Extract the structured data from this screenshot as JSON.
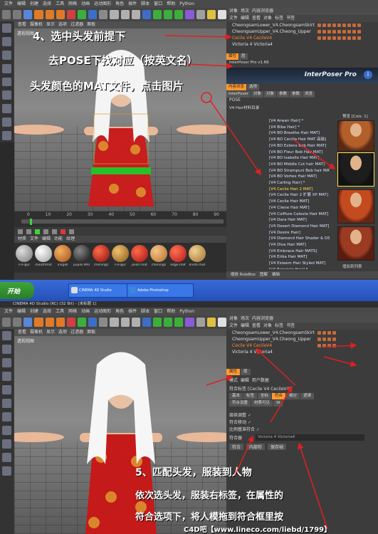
{
  "top": {
    "menu": [
      "文件",
      "编辑",
      "创建",
      "选择",
      "工具",
      "网格",
      "动画",
      "运动图形",
      "角色",
      "插件",
      "脚本",
      "窗口",
      "帮助",
      "Python"
    ],
    "viewport": {
      "menu": [
        "查看",
        "摄像机",
        "显示",
        "选项",
        "过滤器",
        "面板"
      ],
      "label": "透视视图"
    },
    "objects": {
      "header": [
        "对象",
        "场次",
        "内容浏览器"
      ],
      "menu": [
        "文件",
        "编辑",
        "查看",
        "对象",
        "标签",
        "书签"
      ],
      "rows": [
        "CheongsamLower_V4.CheongsamSkirt",
        "CheongsamUpper_V4.Cheong_Upper",
        "Cecile V4 CecileV4",
        "Victoria 4 Victoria4"
      ]
    },
    "interposer": {
      "tabs": [
        "属性",
        "层"
      ],
      "version": "InterPoser Pro v1.66",
      "brand": "InterPoser Pro",
      "info_icon": "info-icon",
      "subtabs": [
        "内容浏览",
        "选项"
      ],
      "tabs2": [
        "InterPoser",
        "对象",
        "对象",
        "参数",
        "参数",
        "浏览"
      ],
      "pose_header": "POSE",
      "tree_label": "V4 Hair材料目录",
      "mat_items": [
        "[V4 Arwen Hair] *",
        "[V4 Biba Hair] *",
        "[V4 BO Breathe Hair MAT]",
        "[V4 BO Cecilia Hair MAT 高级]",
        "[V4 BO Extens Bob Hair MAT]",
        "[V4 BO Fleur Bob Hair MAT]",
        "[V4 BO Isabelle Hair MAT]",
        "[V4 BO Middle Cut hair MAT]",
        "[V4 BO Strampuni Bob hair MAT]",
        "[V4 BO Vortex Hair MAT]",
        "[V4 Carling Hair] *",
        "[V4 Cecile Hair 2 MAT]",
        "[V4 Cecile Hair 2 扩展 XP MAT]",
        "[V4 Cecile Hair MAT]",
        "[V4 Cilene Hair MAT]",
        "[V4 Coiffure Celeste Hair MAT]",
        "[V4 Dara Hair MAT]",
        "[V4 Desert Diamond Hair MAT]",
        "[V4 Desire Hair]",
        "[V4 Diamond Hair Shader & DS]",
        "[V4 Diva Hair MAT]",
        "[V4 Embrace Hair MATS]",
        "[V4 Erika Hair MAT]",
        "[V4 Esteem Hair Styled MAT]",
        "[V4 Fairytale Hair] *",
        "[V4 Flapshy Hair MAT]"
      ],
      "highlight_index": 11,
      "preview_label": "预览 [Cols: 1]",
      "add_button": "增加到列表",
      "footer": [
        "缩放 RuleBox",
        "图解",
        "编辑"
      ]
    },
    "timeline": {
      "ticks": [
        "0",
        "10",
        "20",
        "30",
        "40",
        "50",
        "60",
        "70",
        "80",
        "90"
      ]
    },
    "materials": {
      "menu": [
        "材质",
        "文件",
        "编辑",
        "功能",
        "纹理"
      ],
      "items": [
        "FFFigur",
        "mouthmat",
        "irisgall",
        "pupils.MAT",
        "chenings",
        "FFFigur",
        "pearl.mat",
        "chenings",
        "edge.mat",
        "knots.mat"
      ]
    },
    "annotations": [
      "4、选中头发前提下",
      "去POSE下找对应（按英文名）",
      "头发颜色的MAT文件，点击图片"
    ],
    "colors": {
      "annot": "#ffffff",
      "arrow": "#e02020",
      "highlight": "#ffe14a"
    }
  },
  "taskbar": {
    "start": "开始",
    "items": [
      "CINEMA 4D Studio",
      "Adobe Photoshop"
    ]
  },
  "bottom": {
    "title": "CINEMA 4D Studio (RC) (32 Bit) - [未标题 1]",
    "menu": [
      "文件",
      "编辑",
      "创建",
      "选择",
      "工具",
      "网格",
      "动画",
      "运动图形",
      "角色",
      "插件",
      "脚本",
      "窗口",
      "帮助",
      "Python"
    ],
    "viewport": {
      "menu": [
        "查看",
        "摄像机",
        "显示",
        "选项",
        "过滤器",
        "面板"
      ],
      "label": "透视视图"
    },
    "objects": {
      "header": [
        "对象",
        "场次",
        "内容浏览器"
      ],
      "menu": [
        "文件",
        "编辑",
        "查看",
        "对象",
        "标签",
        "书签"
      ],
      "rows": [
        "CheongsamLower_V4.CheongsamSkirt",
        "CheongsamUpper_V4.Cheong_Upper",
        "Cecile V4 CecileV4",
        "Victoria 4 Victoria4"
      ]
    },
    "attributes": {
      "tabs": [
        "属性",
        "层"
      ],
      "menu": [
        "模式",
        "编辑",
        "用户数据"
      ],
      "title": "符合标签 [Cecile V4 CecileV4]",
      "tabs2": [
        "基本",
        "标签",
        "坐标",
        "符合",
        "细分",
        "遮罩"
      ],
      "tabs3": [
        "符合设置",
        "材质可见",
        "W"
      ],
      "labels": [
        "接续调整",
        "符合移动",
        "比例基准符合"
      ],
      "target_label": "符合器",
      "target_value": "Victoria 4 Victoria4",
      "buttons": [
        "符合",
        "内部符",
        "保存帧"
      ]
    },
    "annotations": [
      "5、匹配头发，服装到人物",
      "依次选头发，服装右标签，在属性的",
      "符合选项下，将人模拖到符合框里按"
    ],
    "watermark": "C4D吧【www.lineco.com/liebd/1799】"
  }
}
